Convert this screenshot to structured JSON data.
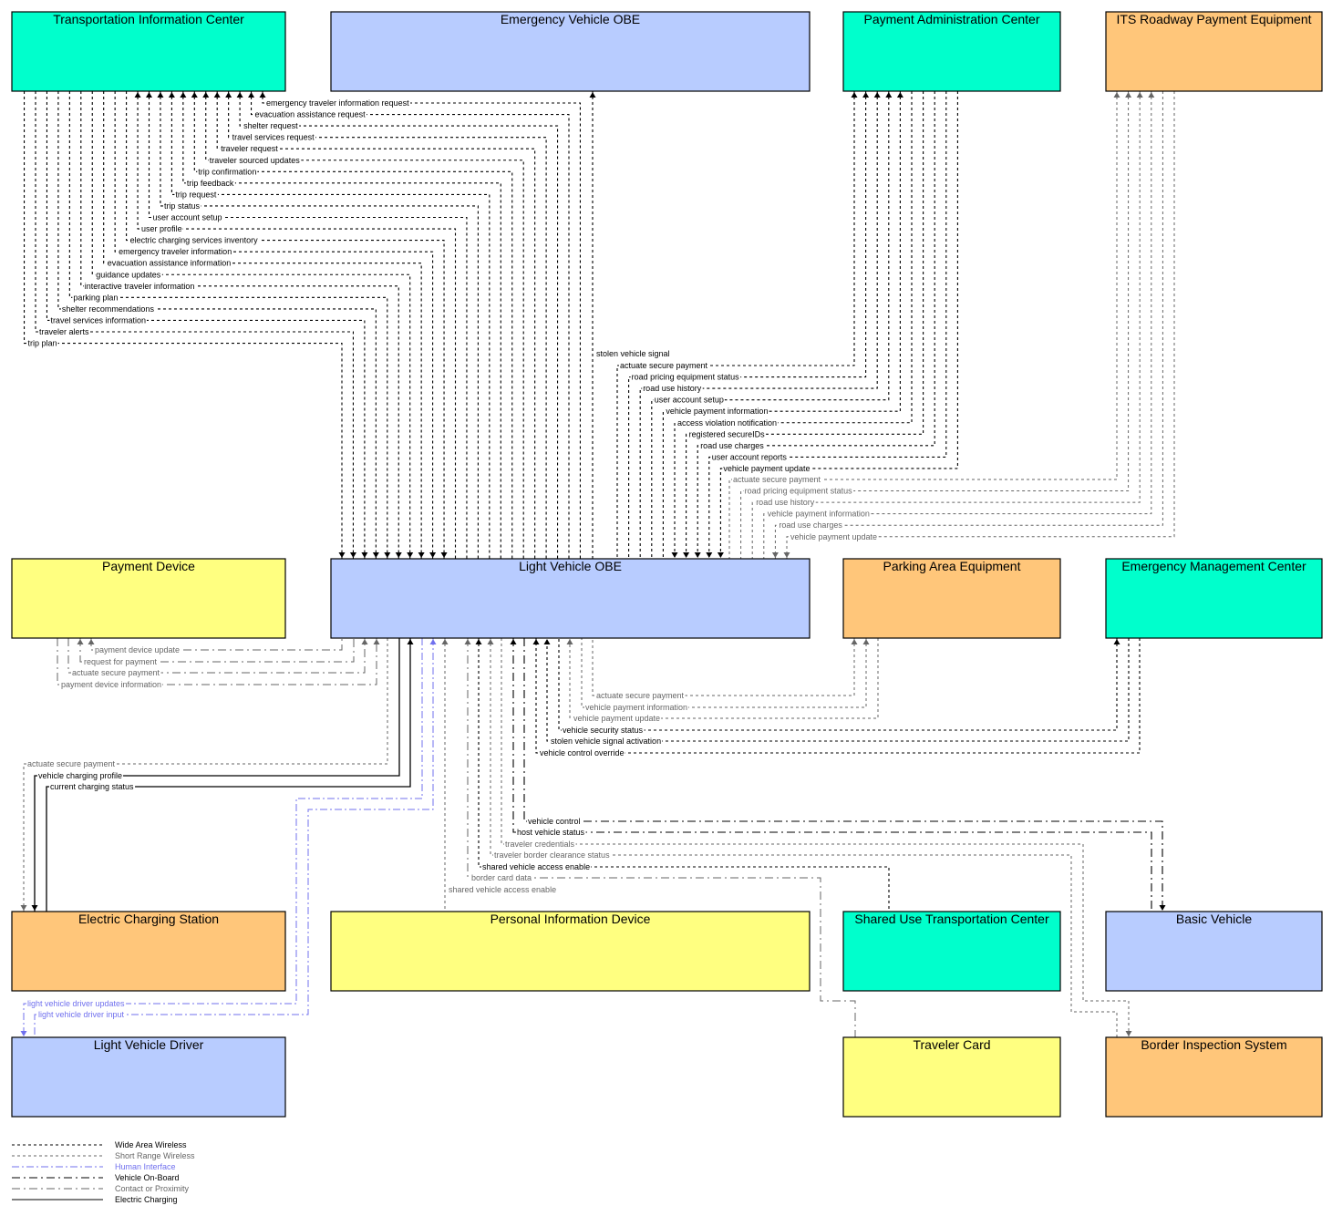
{
  "colors": {
    "center": "#00FFCC",
    "vehicle": "#B8CCFF",
    "field": "#FFC67A",
    "traveler": "#FFFF80",
    "wide_area": "#000000",
    "short_range": "#666666",
    "human": "#7070EE",
    "onboard": "#000000",
    "contact": "#666666",
    "charging": "#000000"
  },
  "legend": [
    {
      "key": "wide_area",
      "label": "Wide Area Wireless"
    },
    {
      "key": "short_range",
      "label": "Short Range Wireless"
    },
    {
      "key": "human",
      "label": "Human Interface"
    },
    {
      "key": "onboard",
      "label": "Vehicle On-Board"
    },
    {
      "key": "contact",
      "label": "Contact or Proximity"
    },
    {
      "key": "charging",
      "label": "Electric Charging"
    }
  ],
  "elements": [
    {
      "id": "tic",
      "label": "Transportation Information Center",
      "kind": "center"
    },
    {
      "id": "evobe",
      "label": "Emergency Vehicle OBE",
      "kind": "vehicle"
    },
    {
      "id": "pac",
      "label": "Payment Administration Center",
      "kind": "center"
    },
    {
      "id": "itsrpe",
      "label": "ITS Roadway Payment Equipment",
      "kind": "field"
    },
    {
      "id": "pd",
      "label": "Payment Device",
      "kind": "traveler"
    },
    {
      "id": "lvobe",
      "label": "Light Vehicle OBE",
      "kind": "vehicle"
    },
    {
      "id": "pae",
      "label": "Parking Area Equipment",
      "kind": "field"
    },
    {
      "id": "emc",
      "label": "Emergency Management Center",
      "kind": "center"
    },
    {
      "id": "ecs",
      "label": "Electric Charging Station",
      "kind": "field"
    },
    {
      "id": "pid",
      "label": "Personal Information Device",
      "kind": "traveler"
    },
    {
      "id": "sutc",
      "label": "Shared Use Transportation Center",
      "kind": "center"
    },
    {
      "id": "bv",
      "label": "Basic Vehicle",
      "kind": "vehicle"
    },
    {
      "id": "lvd",
      "label": "Light Vehicle Driver",
      "kind": "vehicle"
    },
    {
      "id": "tc",
      "label": "Traveler Card",
      "kind": "traveler"
    },
    {
      "id": "bis",
      "label": "Border Inspection System",
      "kind": "field"
    }
  ],
  "flows": {
    "tic_lvobe": [
      {
        "label": "emergency traveler information request",
        "dir": "to_tic"
      },
      {
        "label": "evacuation assistance request",
        "dir": "to_tic"
      },
      {
        "label": "shelter request",
        "dir": "to_tic"
      },
      {
        "label": "travel services request",
        "dir": "to_tic"
      },
      {
        "label": "traveler request",
        "dir": "to_tic"
      },
      {
        "label": "traveler sourced updates",
        "dir": "to_tic"
      },
      {
        "label": "trip confirmation",
        "dir": "to_tic"
      },
      {
        "label": "trip feedback",
        "dir": "to_tic"
      },
      {
        "label": "trip request",
        "dir": "to_tic"
      },
      {
        "label": "trip status",
        "dir": "to_tic"
      },
      {
        "label": "user account setup",
        "dir": "to_tic"
      },
      {
        "label": "user profile",
        "dir": "to_tic"
      },
      {
        "label": "electric charging services inventory",
        "dir": "to_lvobe"
      },
      {
        "label": "emergency traveler information",
        "dir": "to_lvobe"
      },
      {
        "label": "evacuation assistance information",
        "dir": "to_lvobe"
      },
      {
        "label": "guidance updates",
        "dir": "to_lvobe"
      },
      {
        "label": "interactive traveler information",
        "dir": "to_lvobe"
      },
      {
        "label": "parking plan",
        "dir": "to_lvobe"
      },
      {
        "label": "shelter recommendations",
        "dir": "to_lvobe"
      },
      {
        "label": "travel services information",
        "dir": "to_lvobe"
      },
      {
        "label": "traveler alerts",
        "dir": "to_lvobe"
      },
      {
        "label": "trip plan",
        "dir": "to_lvobe"
      }
    ],
    "evobe_lvobe": [
      {
        "label": "stolen vehicle signal",
        "type": "wide_area"
      }
    ],
    "pac_lvobe": [
      {
        "label": "actuate secure payment",
        "dir": "to_pac"
      },
      {
        "label": "road pricing equipment status",
        "dir": "to_pac"
      },
      {
        "label": "road use history",
        "dir": "to_pac"
      },
      {
        "label": "user account setup",
        "dir": "to_pac"
      },
      {
        "label": "vehicle payment information",
        "dir": "to_pac"
      },
      {
        "label": "access violation notification",
        "dir": "to_lvobe"
      },
      {
        "label": "registered secureIDs",
        "dir": "to_lvobe"
      },
      {
        "label": "road use charges",
        "dir": "to_lvobe"
      },
      {
        "label": "user account reports",
        "dir": "to_lvobe"
      },
      {
        "label": "vehicle payment update",
        "dir": "to_lvobe"
      }
    ],
    "itsrpe_lvobe": [
      {
        "label": "actuate secure payment",
        "dir": "to_itsrpe"
      },
      {
        "label": "road pricing equipment status",
        "dir": "to_itsrpe"
      },
      {
        "label": "road use history",
        "dir": "to_itsrpe"
      },
      {
        "label": "vehicle payment information",
        "dir": "to_itsrpe"
      },
      {
        "label": "road use charges",
        "dir": "to_lvobe"
      },
      {
        "label": "vehicle payment update",
        "dir": "to_lvobe"
      }
    ],
    "pd_lvobe": [
      {
        "label": "payment device update",
        "dir": "to_pd"
      },
      {
        "label": "request for payment",
        "dir": "to_pd"
      },
      {
        "label": "actuate secure payment",
        "dir": "to_lvobe"
      },
      {
        "label": "payment device information",
        "dir": "to_lvobe"
      }
    ],
    "pae_lvobe": [
      {
        "label": "actuate secure payment",
        "dir": "to_pae"
      },
      {
        "label": "vehicle payment information",
        "dir": "to_pae"
      },
      {
        "label": "vehicle payment update",
        "dir": "to_lvobe"
      }
    ],
    "emc_lvobe": [
      {
        "label": "vehicle security status",
        "dir": "to_emc"
      },
      {
        "label": "stolen vehicle signal activation",
        "dir": "to_lvobe"
      },
      {
        "label": "vehicle control override",
        "dir": "to_lvobe"
      }
    ],
    "ecs_lvobe": [
      {
        "label": "actuate secure payment",
        "dir": "to_ecs",
        "type": "short_range"
      },
      {
        "label": "vehicle charging profile",
        "dir": "to_ecs",
        "type": "charging"
      },
      {
        "label": "current charging status",
        "dir": "to_lvobe",
        "type": "charging"
      }
    ],
    "lvd_lvobe": [
      {
        "label": "light vehicle driver updates",
        "dir": "to_lvd"
      },
      {
        "label": "light vehicle driver input",
        "dir": "to_lvobe"
      }
    ],
    "bottom_flows": [
      {
        "label": "vehicle control",
        "type": "onboard",
        "target": "bv"
      },
      {
        "label": "host vehicle status",
        "type": "onboard",
        "target": "bv"
      },
      {
        "label": "traveler credentials",
        "type": "short_range",
        "target": "bis"
      },
      {
        "label": "traveler border clearance status",
        "type": "short_range",
        "target": "bis"
      },
      {
        "label": "shared vehicle access enable",
        "type": "wide_area",
        "target": "sutc"
      },
      {
        "label": "border card data",
        "type": "contact",
        "target": "tc"
      },
      {
        "label": "shared vehicle access enable",
        "type": "short_range",
        "target": "pid"
      }
    ]
  }
}
